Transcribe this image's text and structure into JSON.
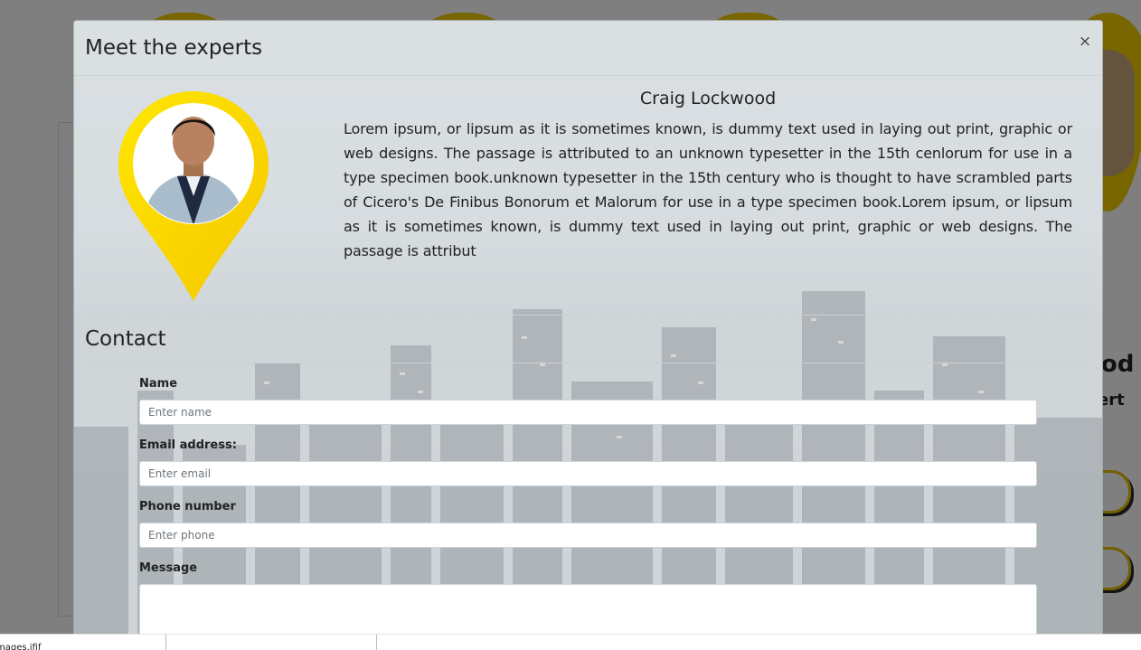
{
  "background": {
    "name_fragment": "ood",
    "role_fragment": "ert",
    "statusbar_text": "mages.jfif"
  },
  "modal": {
    "title": "Meet the experts",
    "close_label": "×",
    "expert": {
      "name": "Craig Lockwood",
      "bio": "Lorem ipsum, or lipsum as it is sometimes known, is dummy text used in laying out print, graphic or web designs. The passage is attributed to an unknown typesetter in the 15th cenlorum for use in a type specimen book.unknown typesetter in the 15th century who is thought to have scrambled parts of Cicero's De Finibus Bonorum et Malorum for use in a type specimen book.Lorem ipsum, or lipsum as it is sometimes known, is dummy text used in laying out print, graphic or web designs. The passage is attribut"
    },
    "contact": {
      "title": "Contact",
      "name_label": "Name",
      "name_placeholder": "Enter name",
      "email_label": "Email address:",
      "email_placeholder": "Enter email",
      "phone_label": "Phone number",
      "phone_placeholder": "Enter phone",
      "message_label": "Message"
    }
  },
  "colors": {
    "accent_yellow": "#f2cd00",
    "overlay": "rgba(0,0,0,0.5)"
  }
}
